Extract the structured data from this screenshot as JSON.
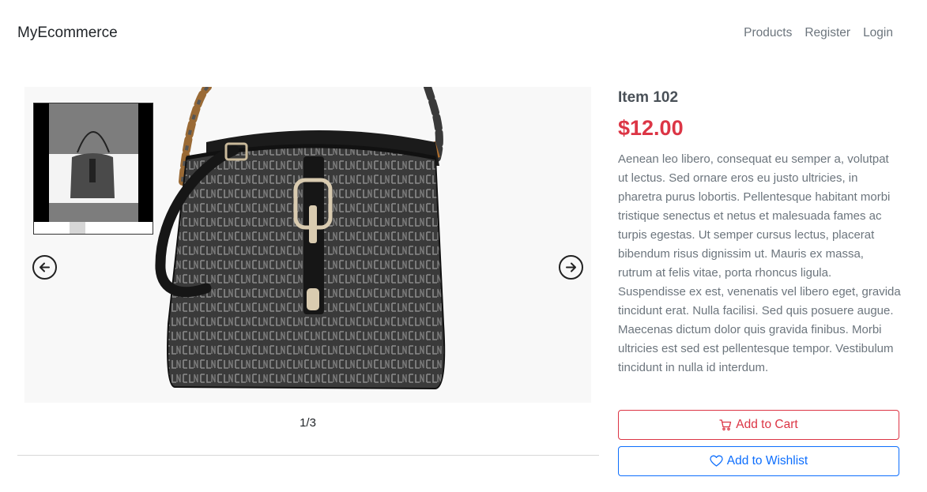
{
  "navbar": {
    "brand": "MyEcommerce",
    "links": [
      {
        "label": "Products"
      },
      {
        "label": "Register"
      },
      {
        "label": "Login"
      }
    ]
  },
  "gallery": {
    "counter": "1/3"
  },
  "product": {
    "title": "Item 102",
    "price": "$12.00",
    "description": "Aenean leo libero, consequat eu semper a, volutpat ut lectus. Sed ornare eros eu justo ultricies, in pharetra purus lobortis. Pellentesque habitant morbi tristique senectus et netus et malesuada fames ac turpis egestas. Ut semper cursus lectus, placerat bibendum risus dignissim ut. Mauris ex massa, rutrum at felis vitae, porta rhoncus ligula. Suspendisse ex est, venenatis vel libero eget, gravida tincidunt erat. Nulla facilisi. Sed quis posuere augue. Maecenas dictum dolor quis gravida finibus. Morbi ultricies est sed est pellentesque tempor. Vestibulum tincidunt in nulla id interdum."
  },
  "actions": {
    "add_to_cart": "Add to Cart",
    "add_to_wishlist": "Add to Wishlist"
  },
  "colors": {
    "price": "#dc3545",
    "cart_button": "#dc3545",
    "wishlist_button": "#0d6efd"
  },
  "icons": {
    "cart": "cart-icon",
    "wishlist": "heart-icon",
    "prev": "arrow-left-circle-icon",
    "next": "arrow-right-circle-icon"
  }
}
